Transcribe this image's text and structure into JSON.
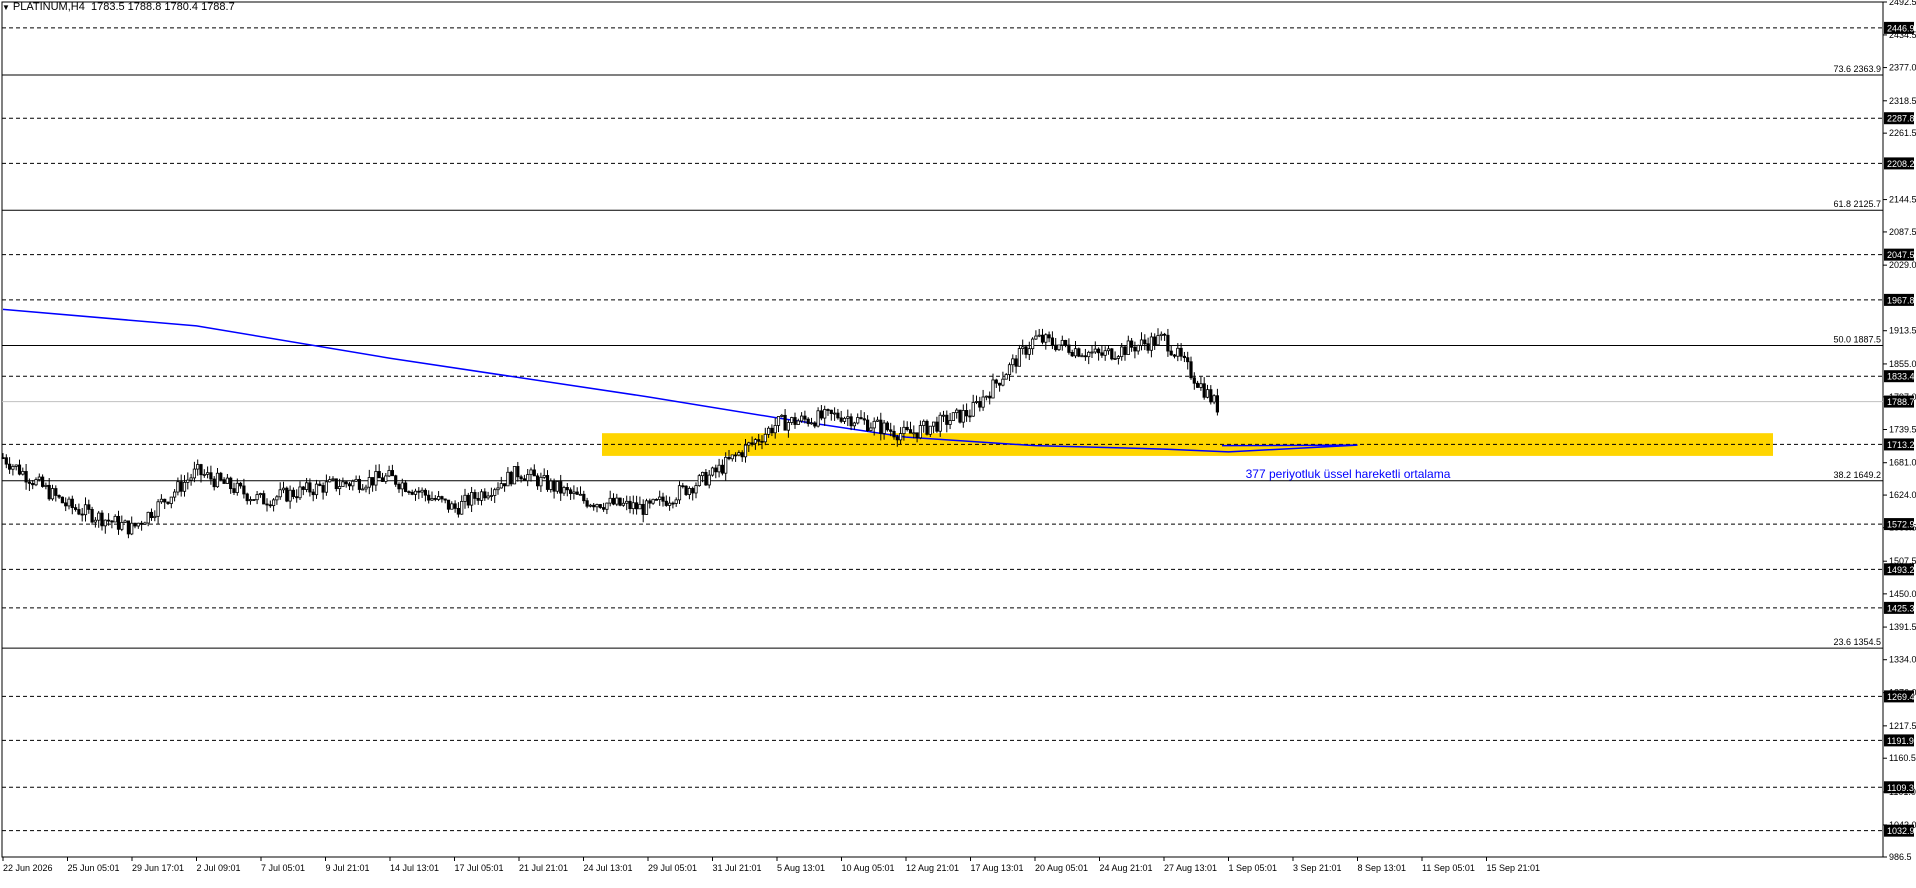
{
  "header": {
    "symbol": "PLATINUM,H4",
    "ohlc": "1783.5 1788.8 1780.4 1788.7"
  },
  "colors": {
    "background": "#ffffff",
    "candle": "#000000",
    "ema_line": "#0000ff",
    "zone_fill": "#ffd500",
    "annotation_text": "#0000ff",
    "price_tag_bg": "#000000"
  },
  "chart_data": {
    "type": "candlestick",
    "title": "",
    "ylim": [
      986.5,
      2492.5
    ],
    "price_scale_ticks": [
      "2492.5",
      "2434.5",
      "2377.0",
      "2318.5",
      "2261.5",
      "2144.5",
      "2087.5",
      "2029.0",
      "1913.5",
      "1855.0",
      "1797.0",
      "1739.5",
      "1681.0",
      "1624.0",
      "1566.5",
      "1507.5",
      "1450.0",
      "1391.5",
      "1334.0",
      "1276.0",
      "1217.5",
      "1160.5",
      "1101.0",
      "1043.0",
      "986.5"
    ],
    "time_labels": [
      "22 Jun 2026",
      "25 Jun 05:01",
      "29 Jun 17:01",
      "2 Jul 09:01",
      "7 Jul 05:01",
      "9 Jul 21:01",
      "14 Jul 13:01",
      "17 Jul 05:01",
      "21 Jul 21:01",
      "24 Jul 13:01",
      "29 Jul 05:01",
      "31 Jul 21:01",
      "5 Aug 13:01",
      "10 Aug 05:01",
      "12 Aug 21:01",
      "17 Aug 13:01",
      "20 Aug 05:01",
      "24 Aug 21:01",
      "27 Aug 13:01",
      "1 Sep 05:01",
      "3 Sep 21:01",
      "8 Sep 13:01",
      "11 Sep 05:01",
      "15 Sep 21:01"
    ],
    "horizontal_levels": [
      {
        "price": 2446.9,
        "style": "dashed",
        "tag": "2446.9"
      },
      {
        "price": 2287.8,
        "style": "dashed",
        "tag": "2287.8"
      },
      {
        "price": 2208.2,
        "style": "dashed",
        "tag": "2208.2"
      },
      {
        "price": 2047.5,
        "style": "dashed",
        "tag": "2047.5"
      },
      {
        "price": 1967.8,
        "style": "dashed",
        "tag": "1967.8"
      },
      {
        "price": 1833.4,
        "style": "dashed",
        "tag": "1833.4"
      },
      {
        "price": 1713.2,
        "style": "dashed",
        "tag": "1713.2"
      },
      {
        "price": 1572.9,
        "style": "dashed",
        "tag": "1572.9"
      },
      {
        "price": 1493.2,
        "style": "dashed",
        "tag": "1493.2"
      },
      {
        "price": 1425.3,
        "style": "dashed",
        "tag": "1425.3"
      },
      {
        "price": 1269.4,
        "style": "dashed",
        "tag": "1269.4"
      },
      {
        "price": 1191.9,
        "style": "dashed",
        "tag": "1191.9"
      },
      {
        "price": 1109.3,
        "style": "dashed",
        "tag": "1109.3"
      },
      {
        "price": 1032.9,
        "style": "dashed",
        "tag": "1032.9"
      }
    ],
    "current_price": {
      "price": 1788.7,
      "tag": "1788.7"
    },
    "fibonacci_levels": [
      {
        "price": 2363.9,
        "label": "73.6 2363.9"
      },
      {
        "price": 2125.7,
        "label": "61.8 2125.7"
      },
      {
        "price": 1887.5,
        "label": "50.0 1887.5"
      },
      {
        "price": 1649.2,
        "label": "38.2 1649.2"
      },
      {
        "price": 1354.5,
        "label": "23.6 1354.5"
      }
    ],
    "support_zone": {
      "low": 1693,
      "high": 1733
    },
    "ema": {
      "period": 377,
      "label": "377 periyotluk üssel hareketli ortalama",
      "x": [
        "22 Jun 2026",
        "2 Jul 09:01",
        "14 Jul 13:01",
        "29 Jul 05:01",
        "5 Aug 13:01",
        "12 Aug 21:01",
        "20 Aug 05:01",
        "27 Aug 13:01",
        "1 Sep 05:01",
        "8 Sep 13:01",
        "15 Sep 21:01"
      ],
      "y": [
        1951,
        1922,
        1865,
        1797,
        1760,
        1726,
        1711,
        1705,
        1700,
        1712,
        1711
      ]
    },
    "price_path": {
      "x": [
        "22 Jun 2026",
        "25 Jun 05:01",
        "29 Jun 17:01",
        "2 Jul 09:01",
        "7 Jul 05:01",
        "9 Jul 21:01",
        "14 Jul 13:01",
        "17 Jul 05:01",
        "21 Jul 21:01",
        "24 Jul 13:01",
        "29 Jul 05:01",
        "31 Jul 21:01",
        "5 Aug 13:01",
        "10 Aug 05:01",
        "12 Aug 21:01",
        "17 Aug 13:01",
        "20 Aug 05:01",
        "24 Aug 21:01",
        "27 Aug 13:01",
        "1 Sep 05:01",
        "3 Sep 21:01",
        "8 Sep 13:01",
        "11 Sep 05:01",
        "15 Sep 21:01"
      ],
      "y": [
        1690,
        1605,
        1565,
        1665,
        1615,
        1640,
        1655,
        1600,
        1665,
        1615,
        1600,
        1660,
        1750,
        1765,
        1730,
        1770,
        1900,
        1870,
        1900,
        1755,
        1830,
        1880,
        1770,
        1790
      ]
    }
  }
}
